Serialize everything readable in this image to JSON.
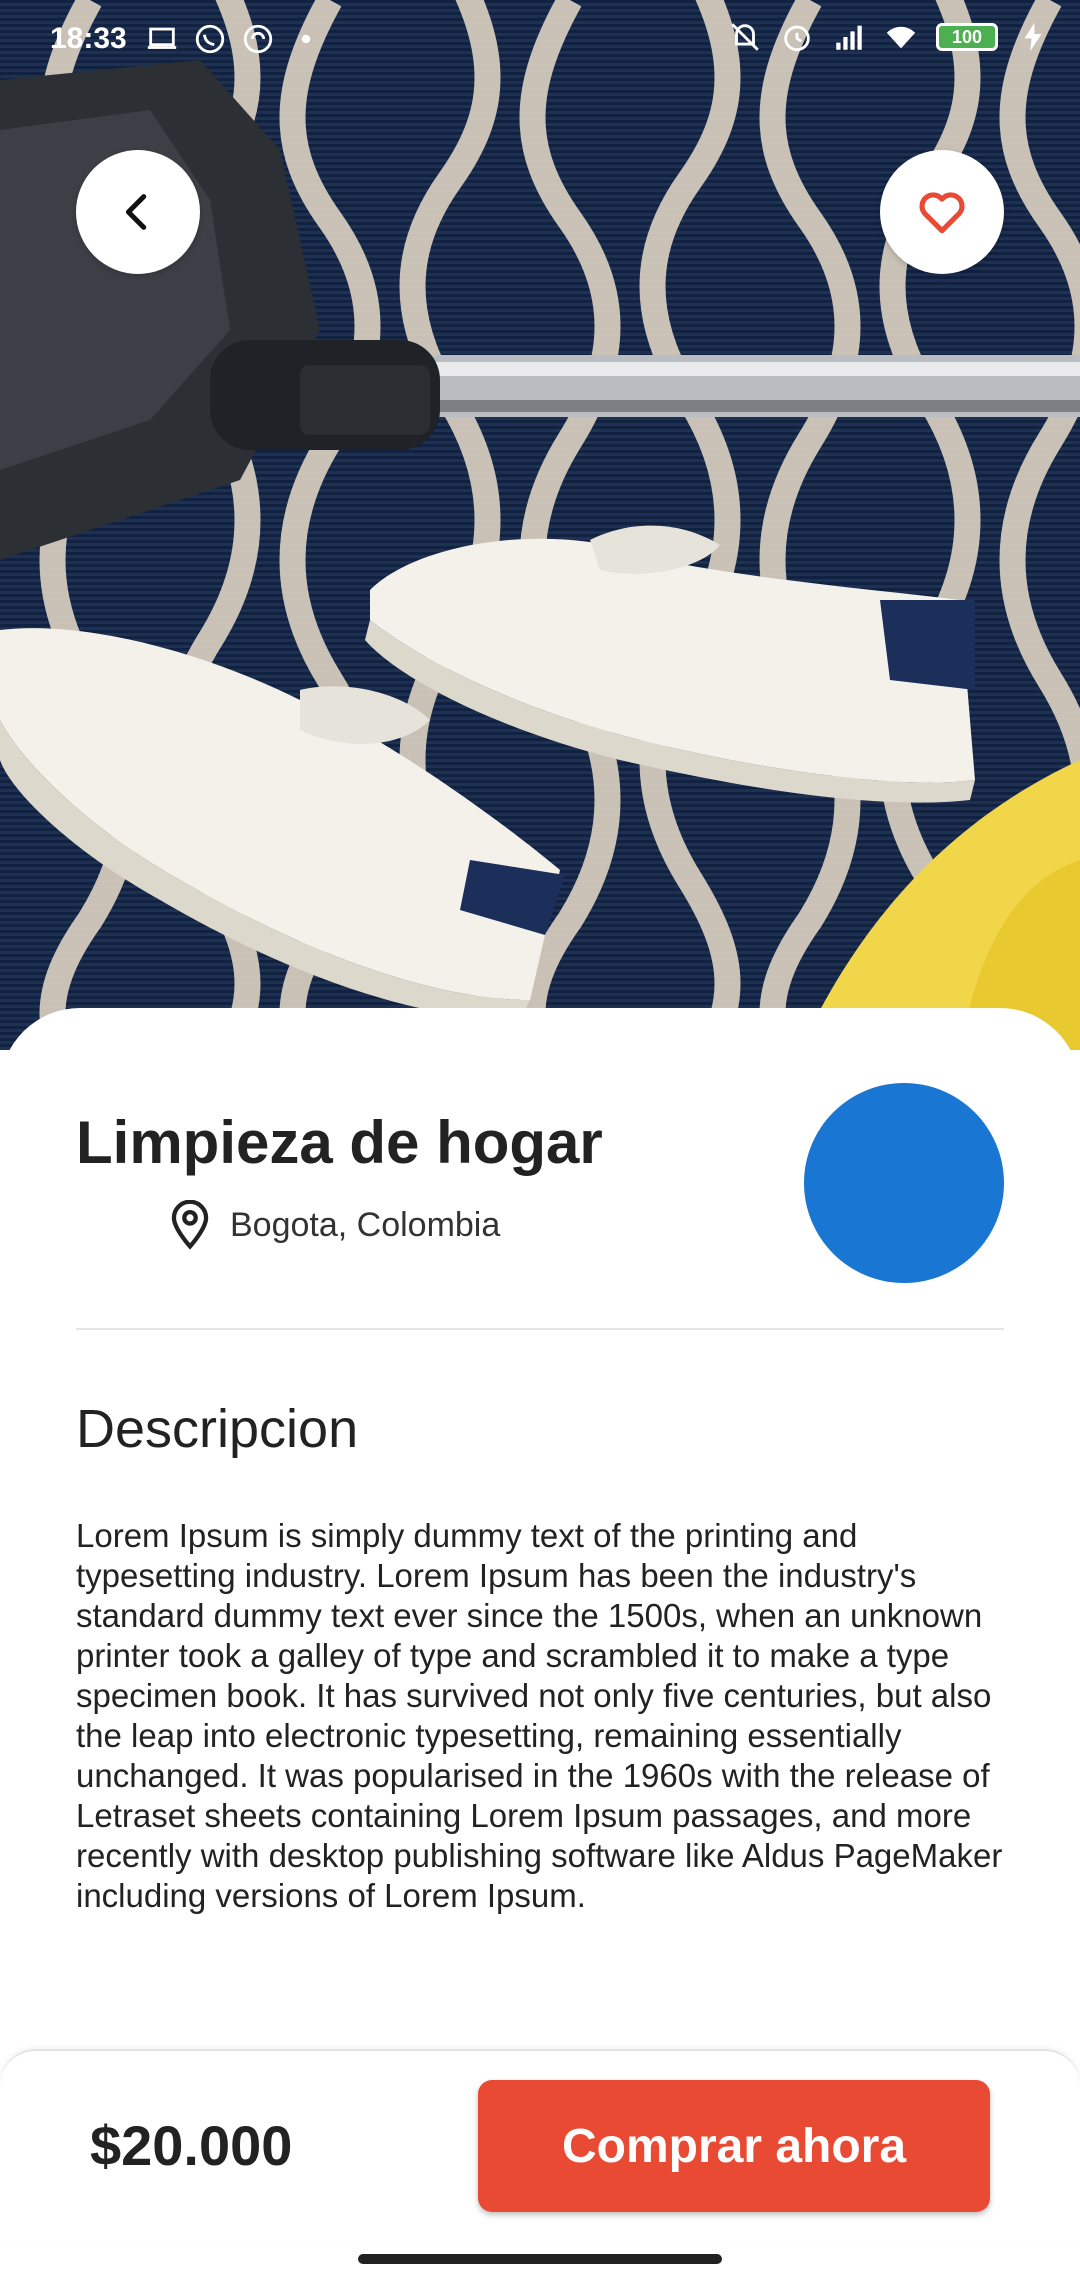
{
  "status_bar": {
    "time": "18:33",
    "battery": "100",
    "left_icons": [
      "laptop-icon",
      "whatsapp-icon",
      "sync-icon",
      "dot-icon"
    ],
    "right_icons": [
      "mute-icon",
      "alarm-icon",
      "signal-icon",
      "wifi-icon",
      "battery-icon",
      "charging-icon"
    ]
  },
  "header": {
    "back_icon": "chevron-left-icon",
    "favorite_icon": "heart-icon",
    "hero_image": "sneakers-and-vacuum-on-patterned-rug"
  },
  "product": {
    "title": "Limpieza de hogar",
    "location": "Bogota, Colombia",
    "location_icon": "map-pin-icon",
    "avatar_color": "#1976d2"
  },
  "description": {
    "heading": "Descripcion",
    "body": "Lorem Ipsum is simply dummy text of the printing and typesetting industry. Lorem Ipsum has been the industry's standard dummy text ever since the 1500s, when an unknown printer took a galley of type and scrambled it to make a type specimen book. It has survived not only five centuries, but also the leap into electronic typesetting, remaining essentially unchanged. It was popularised in the 1960s with the release of Letraset sheets containing Lorem Ipsum passages, and more recently with desktop publishing software like Aldus PageMaker including versions of Lorem Ipsum."
  },
  "purchase": {
    "price": "$20.000",
    "buy_label": "Comprar ahora",
    "accent_color": "#e84a33"
  }
}
